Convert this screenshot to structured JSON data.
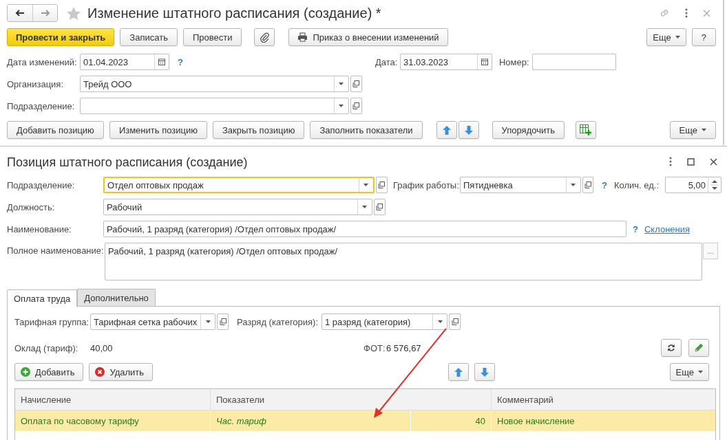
{
  "document": {
    "title": "Изменение штатного расписания (создание) *",
    "toolbar": [
      {
        "kind": "primary",
        "label": "Провести и закрыть"
      },
      {
        "kind": "button",
        "label": "Записать"
      },
      {
        "kind": "button",
        "label": "Провести"
      },
      {
        "kind": "attach"
      },
      {
        "kind": "print",
        "label": "Приказ о внесении изменений"
      },
      {
        "kind": "more",
        "label": "Еще"
      },
      {
        "kind": "button",
        "label": "?"
      }
    ],
    "change_date": {
      "label": "Дата изменений:",
      "value": "01.04.2023",
      "hint": "?"
    },
    "date": {
      "label": "Дата:",
      "value": "31.03.2023"
    },
    "number": {
      "label": "Номер:"
    },
    "organization": {
      "label": "Организация:",
      "value": "Трейд ООО"
    },
    "department": {
      "label": "Подразделение:"
    },
    "positions_toolbar": [
      {
        "kind": "button",
        "label": "Добавить позицию"
      },
      {
        "kind": "button",
        "label": "Изменить позицию"
      },
      {
        "kind": "button",
        "label": "Закрыть позицию"
      },
      {
        "kind": "button",
        "label": "Заполнить показатели"
      },
      {
        "kind": "up"
      },
      {
        "kind": "down"
      },
      {
        "kind": "sort",
        "label": "Упорядочить"
      },
      {
        "kind": "table-add"
      },
      {
        "kind": "more",
        "label": "Еще"
      }
    ]
  },
  "position_dialog": {
    "title": "Позиция штатного расписания (создание)",
    "department": {
      "label": "Подразделение:",
      "value": "Отдел оптовых продаж",
      "focused": true
    },
    "schedule": {
      "label": "График работы:",
      "value": "Пятидневка",
      "hint": "?"
    },
    "units": {
      "label": "Колич. ед.:",
      "value": "5,00"
    },
    "position": {
      "label": "Должность:",
      "value": "Рабочий"
    },
    "name": {
      "label": "Наименование:",
      "value": "Рабочий, 1 разряд (категория) /Отдел оптовых продаж/",
      "hint": "?",
      "link": "Склонения"
    },
    "full_name": {
      "label": "Полное наименование:",
      "value": "Рабочий, 1 разряд (категория) /Отдел оптовых продаж/",
      "button": "..."
    },
    "tabs": [
      {
        "label": "Оплата труда",
        "selected": true
      },
      {
        "label": "Дополнительно",
        "selected": false
      }
    ],
    "tariff_group": {
      "label": "Тарифная группа:",
      "value": "Тарифная сетка рабочих"
    },
    "grade": {
      "label": "Разряд (категория):",
      "value": "1 разряд (категория)"
    },
    "salary": {
      "label": "Оклад (тариф):",
      "value": "40,00"
    },
    "payroll": {
      "label": "ФОТ:",
      "value": "6 576,67"
    },
    "accruals_toolbar": [
      {
        "kind": "add",
        "label": "Добавить"
      },
      {
        "kind": "delete",
        "label": "Удалить"
      },
      {
        "kind": "up"
      },
      {
        "kind": "down"
      },
      {
        "kind": "more",
        "label": "Еще"
      }
    ],
    "table": {
      "columns": [
        "Начисление",
        "Показатели",
        "Комментарий"
      ],
      "rows": [
        {
          "selected": true,
          "cells": [
            "Оплата по часовому тарифу",
            {
              "indicator": "Час. тариф",
              "value": "40"
            },
            "Новое начисление"
          ]
        }
      ]
    }
  }
}
